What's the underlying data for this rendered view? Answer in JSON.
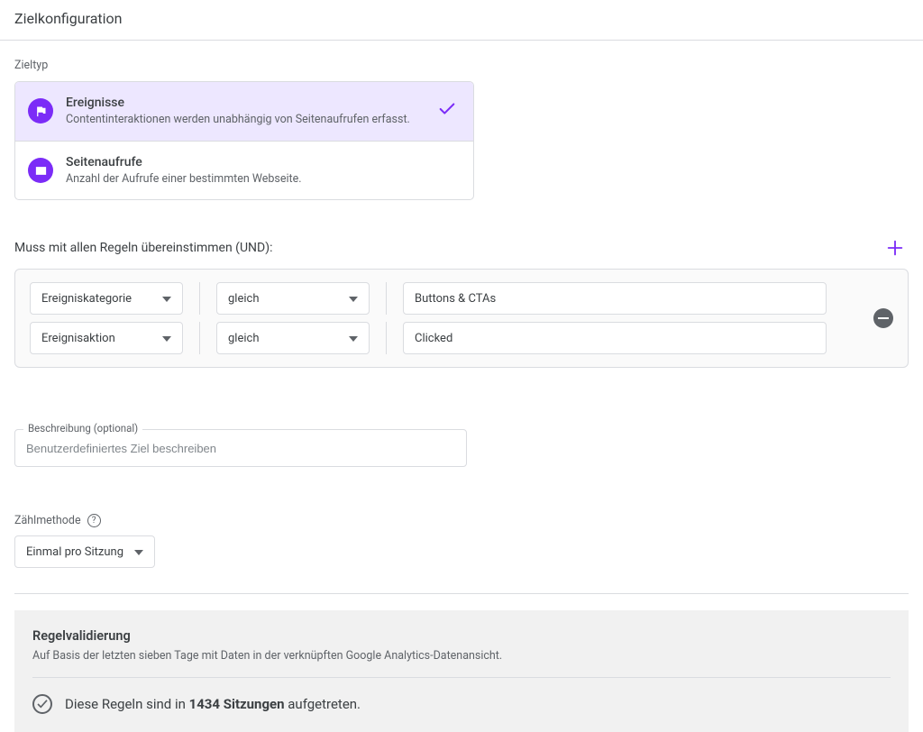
{
  "page_title": "Zielkonfiguration",
  "zieltyp": {
    "label": "Zieltyp",
    "options": [
      {
        "title": "Ereignisse",
        "desc": "Contentinteraktionen werden unabhängig von Seitenaufrufen erfasst.",
        "selected": true
      },
      {
        "title": "Seitenaufrufe",
        "desc": "Anzahl der Aufrufe einer bestimmten Webseite.",
        "selected": false
      }
    ]
  },
  "rules": {
    "header": "Muss mit allen Regeln übereinstimmen (UND):",
    "rows": [
      {
        "attribute": "Ereigniskategorie",
        "operator": "gleich",
        "value": "Buttons & CTAs"
      },
      {
        "attribute": "Ereignisaktion",
        "operator": "gleich",
        "value": "Clicked"
      }
    ]
  },
  "description": {
    "label": "Beschreibung (optional)",
    "placeholder": "Benutzerdefiniertes Ziel beschreiben",
    "value": ""
  },
  "counting": {
    "label": "Zählmethode",
    "selected": "Einmal pro Sitzung"
  },
  "validation": {
    "title": "Regelvalidierung",
    "subtitle": "Auf Basis der letzten sieben Tage mit Daten in der verknüpften Google Analytics-Datenansicht.",
    "result_prefix": "Diese Regeln sind in ",
    "result_count": "1434 Sitzungen",
    "result_suffix": " aufgetreten."
  }
}
